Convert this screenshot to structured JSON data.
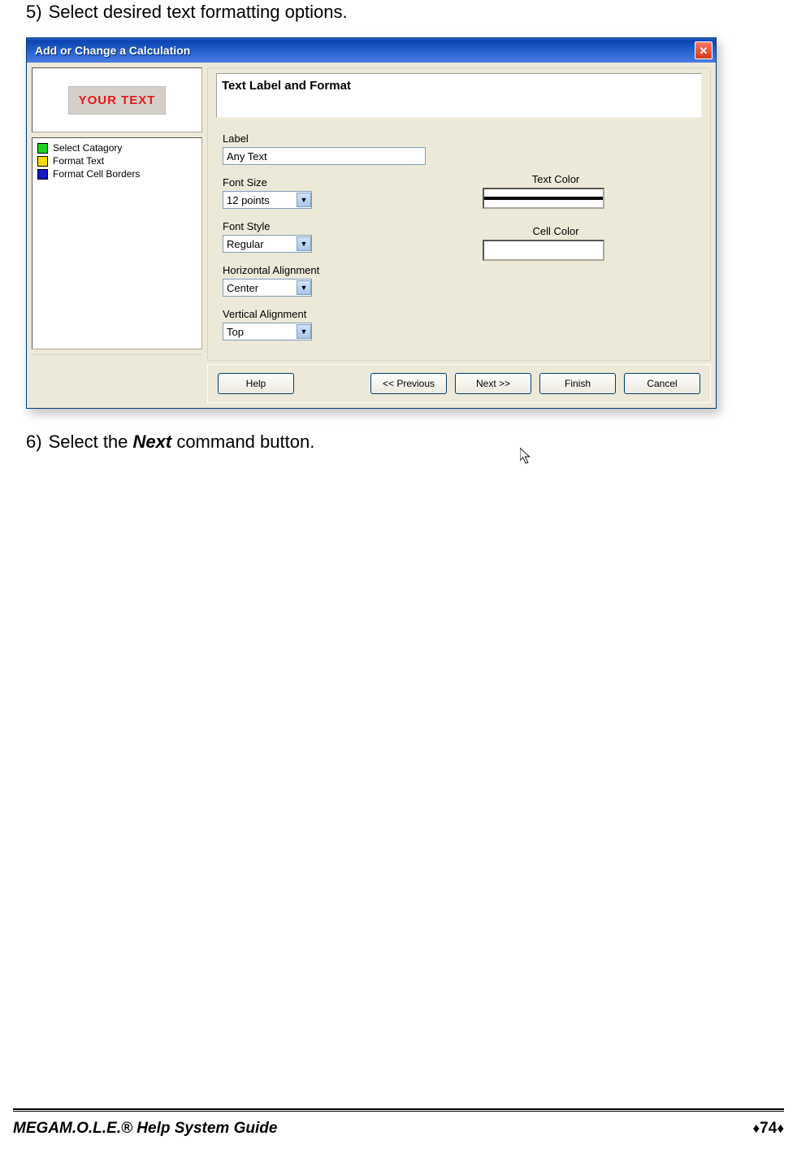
{
  "step5": {
    "num": "5)",
    "text": "Select desired text formatting options."
  },
  "dialog": {
    "title": "Add or Change a Calculation",
    "preview_text": "YOUR TEXT",
    "steps": {
      "s1": "Select Catagory",
      "s2": "Format Text",
      "s3": "Format Cell Borders"
    },
    "panel_header": "Text Label and Format",
    "fields": {
      "label_label": "Label",
      "label_value": "Any Text",
      "fontsize_label": "Font Size",
      "fontsize_value": "12 points",
      "fontstyle_label": "Font Style",
      "fontstyle_value": "Regular",
      "halign_label": "Horizontal Alignment",
      "halign_value": "Center",
      "valign_label": "Vertical Alignment",
      "valign_value": "Top",
      "textcolor_label": "Text Color",
      "cellcolor_label": "Cell Color"
    },
    "buttons": {
      "help": "Help",
      "prev": "<< Previous",
      "next": "Next >>",
      "finish": "Finish",
      "cancel": "Cancel"
    }
  },
  "step6": {
    "num": "6)",
    "prefix": "Select the ",
    "emph": "Next",
    "suffix": " command button."
  },
  "footer": {
    "mega": "MEGA",
    "rest": "M.O.L.E.® Help System Guide",
    "diamond": "♦",
    "page": "74"
  }
}
